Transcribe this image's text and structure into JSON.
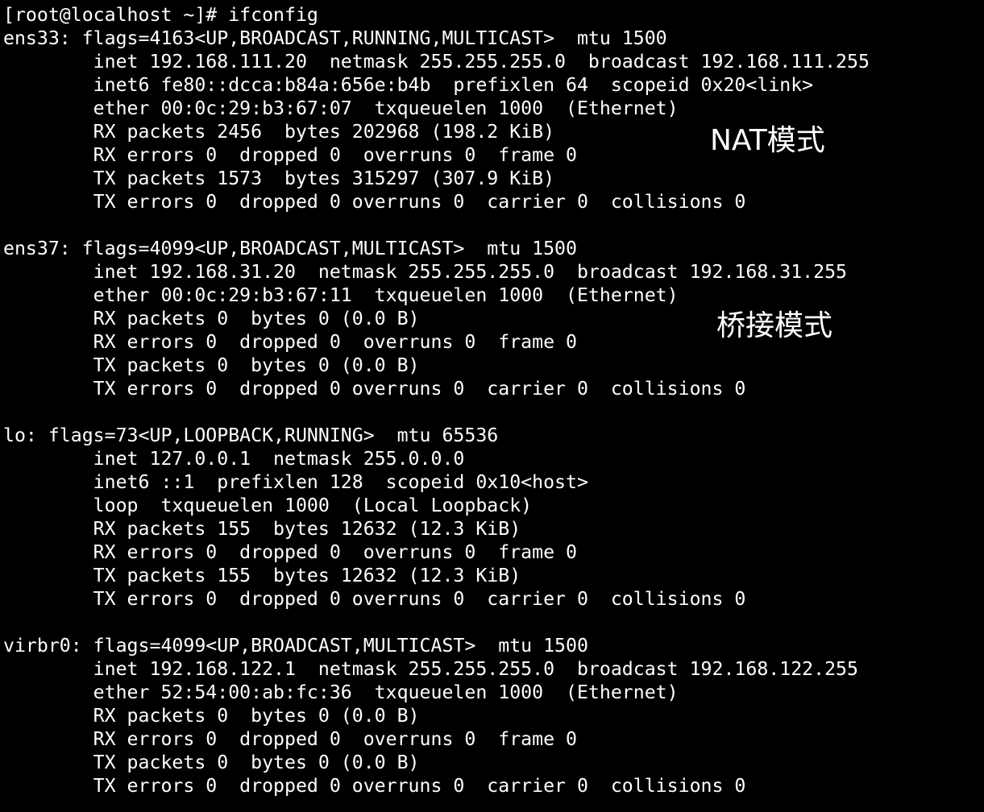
{
  "terminal": {
    "lines": [
      "[root@localhost ~]# ifconfig",
      "ens33: flags=4163<UP,BROADCAST,RUNNING,MULTICAST>  mtu 1500",
      "        inet 192.168.111.20  netmask 255.255.255.0  broadcast 192.168.111.255",
      "        inet6 fe80::dcca:b84a:656e:b4b  prefixlen 64  scopeid 0x20<link>",
      "        ether 00:0c:29:b3:67:07  txqueuelen 1000  (Ethernet)",
      "        RX packets 2456  bytes 202968 (198.2 KiB)",
      "        RX errors 0  dropped 0  overruns 0  frame 0",
      "        TX packets 1573  bytes 315297 (307.9 KiB)",
      "        TX errors 0  dropped 0 overruns 0  carrier 0  collisions 0",
      "",
      "ens37: flags=4099<UP,BROADCAST,MULTICAST>  mtu 1500",
      "        inet 192.168.31.20  netmask 255.255.255.0  broadcast 192.168.31.255",
      "        ether 00:0c:29:b3:67:11  txqueuelen 1000  (Ethernet)",
      "        RX packets 0  bytes 0 (0.0 B)",
      "        RX errors 0  dropped 0  overruns 0  frame 0",
      "        TX packets 0  bytes 0 (0.0 B)",
      "        TX errors 0  dropped 0 overruns 0  carrier 0  collisions 0",
      "",
      "lo: flags=73<UP,LOOPBACK,RUNNING>  mtu 65536",
      "        inet 127.0.0.1  netmask 255.0.0.0",
      "        inet6 ::1  prefixlen 128  scopeid 0x10<host>",
      "        loop  txqueuelen 1000  (Local Loopback)",
      "        RX packets 155  bytes 12632 (12.3 KiB)",
      "        RX errors 0  dropped 0  overruns 0  frame 0",
      "        TX packets 155  bytes 12632 (12.3 KiB)",
      "        TX errors 0  dropped 0 overruns 0  carrier 0  collisions 0",
      "",
      "virbr0: flags=4099<UP,BROADCAST,MULTICAST>  mtu 1500",
      "        inet 192.168.122.1  netmask 255.255.255.0  broadcast 192.168.122.255",
      "        ether 52:54:00:ab:fc:36  txqueuelen 1000  (Ethernet)",
      "        RX packets 0  bytes 0 (0.0 B)",
      "        RX errors 0  dropped 0  overruns 0  frame 0",
      "        TX packets 0  bytes 0 (0.0 B)",
      "        TX errors 0  dropped 0 overruns 0  carrier 0  collisions 0"
    ]
  },
  "annotations": {
    "nat_mode": "NAT模式",
    "bridge_mode": "桥接模式"
  },
  "colors": {
    "background": "#000000",
    "text": "#ffffff"
  }
}
